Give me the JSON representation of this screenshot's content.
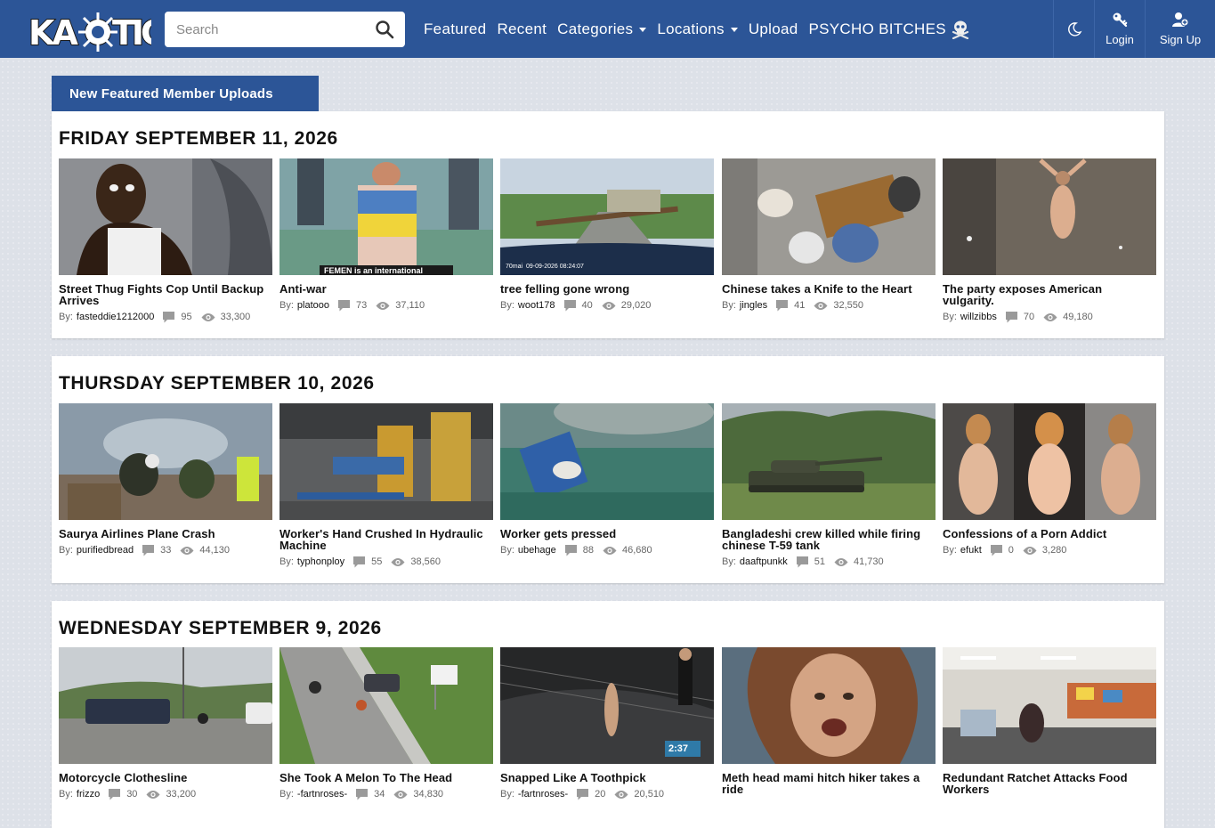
{
  "header": {
    "brand": "KAOTIC",
    "search": {
      "placeholder": "Search",
      "value": ""
    },
    "nav": [
      {
        "label": "Featured",
        "dropdown": false
      },
      {
        "label": "Recent",
        "dropdown": false
      },
      {
        "label": "Categories",
        "dropdown": true
      },
      {
        "label": "Locations",
        "dropdown": true
      },
      {
        "label": "Upload",
        "dropdown": false
      },
      {
        "label": "PSYCHO BITCHES",
        "dropdown": false,
        "icon": "skull-icon"
      }
    ],
    "theme_icon": "moon-icon",
    "login_label": "Login",
    "signup_label": "Sign Up",
    "bg_color": "#2c5597"
  },
  "tab_label": "New Featured Member Uploads",
  "by_label": "By:",
  "sections": [
    {
      "date": "FRIDAY SEPTEMBER 11, 2026",
      "items": [
        {
          "title": "Street Thug Fights Cop Until Backup Arrives",
          "user": "fasteddie1212000",
          "comments": "95",
          "views": "33,300",
          "overlay": ""
        },
        {
          "title": "Anti-war",
          "user": "platooo",
          "comments": "73",
          "views": "37,110",
          "overlay": "FEMEN is an international"
        },
        {
          "title": "tree felling gone wrong",
          "user": "woot178",
          "comments": "40",
          "views": "29,020",
          "overlay": "70mai  09-09-2026 08:24:07"
        },
        {
          "title": "Chinese takes a Knife to the Heart",
          "user": "jingles",
          "comments": "41",
          "views": "32,550",
          "overlay": ""
        },
        {
          "title": "The party exposes American vulgarity.",
          "user": "willzibbs",
          "comments": "70",
          "views": "49,180",
          "overlay": ""
        }
      ]
    },
    {
      "date": "THURSDAY SEPTEMBER 10, 2026",
      "items": [
        {
          "title": "Saurya Airlines Plane Crash",
          "user": "purifiedbread",
          "comments": "33",
          "views": "44,130",
          "overlay": ""
        },
        {
          "title": "Worker's Hand Crushed In Hydraulic Machine",
          "user": "typhonploy",
          "comments": "55",
          "views": "38,560",
          "overlay": ""
        },
        {
          "title": "Worker gets pressed",
          "user": "ubehage",
          "comments": "88",
          "views": "46,680",
          "overlay": ""
        },
        {
          "title": "Bangladeshi crew killed while firing chinese T-59 tank",
          "user": "daaftpunkk",
          "comments": "51",
          "views": "41,730",
          "overlay": ""
        },
        {
          "title": "Confessions of a Porn Addict",
          "user": "efukt",
          "comments": "0",
          "views": "3,280",
          "overlay": ""
        }
      ]
    },
    {
      "date": "WEDNESDAY SEPTEMBER 9, 2026",
      "items": [
        {
          "title": "Motorcycle Clothesline",
          "user": "frizzo",
          "comments": "30",
          "views": "33,200",
          "overlay": ""
        },
        {
          "title": "She Took A Melon To The Head",
          "user": "-fartnroses-",
          "comments": "34",
          "views": "34,830",
          "overlay": ""
        },
        {
          "title": "Snapped Like A Toothpick",
          "user": "-fartnroses-",
          "comments": "20",
          "views": "20,510",
          "overlay": "2:37"
        },
        {
          "title": "Meth head mami hitch hiker takes a ride",
          "user": "",
          "comments": "",
          "views": "",
          "overlay": ""
        },
        {
          "title": "Redundant Ratchet Attacks Food Workers",
          "user": "",
          "comments": "",
          "views": "",
          "overlay": ""
        }
      ]
    }
  ]
}
